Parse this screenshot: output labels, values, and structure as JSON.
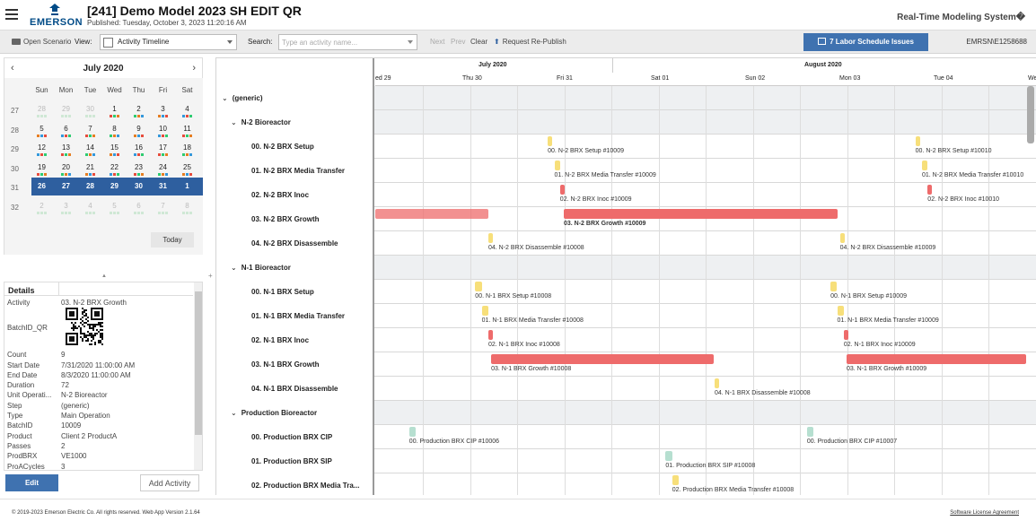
{
  "header": {
    "logo_text": "EMERSON",
    "title": "[241] Demo Model 2023 SH EDIT QR",
    "published": "Published: Tuesday, October 3, 2023 11:20:16 AM",
    "system_name": "Real-Time Modeling System�"
  },
  "toolbar": {
    "open_scenario": "Open Scenario",
    "view_label": "View:",
    "view_value": "Activity Timeline",
    "search_label": "Search:",
    "search_placeholder": "Type an activity name...",
    "next": "Next",
    "prev": "Prev",
    "clear": "Clear",
    "republish": "Request Re-Publish",
    "labor_issues": "7 Labor Schedule Issues",
    "user": "EMRSN\\E1258688"
  },
  "calendar": {
    "month_title": "July 2020",
    "prev_icon": "‹",
    "next_icon": "›",
    "day_names": [
      "Sun",
      "Mon",
      "Tue",
      "Wed",
      "Thu",
      "Fri",
      "Sat"
    ],
    "weeks": [
      {
        "num": "27",
        "days": [
          {
            "d": "28",
            "o": true
          },
          {
            "d": "29",
            "o": true
          },
          {
            "d": "30",
            "o": true
          },
          {
            "d": "1"
          },
          {
            "d": "2"
          },
          {
            "d": "3"
          },
          {
            "d": "4"
          }
        ]
      },
      {
        "num": "28",
        "days": [
          {
            "d": "5"
          },
          {
            "d": "6"
          },
          {
            "d": "7"
          },
          {
            "d": "8"
          },
          {
            "d": "9"
          },
          {
            "d": "10"
          },
          {
            "d": "11"
          }
        ]
      },
      {
        "num": "29",
        "days": [
          {
            "d": "12"
          },
          {
            "d": "13"
          },
          {
            "d": "14"
          },
          {
            "d": "15"
          },
          {
            "d": "16"
          },
          {
            "d": "17"
          },
          {
            "d": "18"
          }
        ]
      },
      {
        "num": "30",
        "days": [
          {
            "d": "19"
          },
          {
            "d": "20"
          },
          {
            "d": "21"
          },
          {
            "d": "22"
          },
          {
            "d": "23"
          },
          {
            "d": "24"
          },
          {
            "d": "25"
          }
        ]
      },
      {
        "num": "31",
        "selected": true,
        "days": [
          {
            "d": "26"
          },
          {
            "d": "27"
          },
          {
            "d": "28"
          },
          {
            "d": "29"
          },
          {
            "d": "30"
          },
          {
            "d": "31"
          },
          {
            "d": "1"
          }
        ]
      },
      {
        "num": "32",
        "days": [
          {
            "d": "2",
            "o": true
          },
          {
            "d": "3",
            "o": true
          },
          {
            "d": "4",
            "o": true
          },
          {
            "d": "5",
            "o": true
          },
          {
            "d": "6",
            "o": true
          },
          {
            "d": "7",
            "o": true
          },
          {
            "d": "8",
            "o": true
          }
        ]
      }
    ],
    "today_label": "Today"
  },
  "details": {
    "title": "Details",
    "rows": [
      {
        "k": "Activity",
        "v": "03. N-2 BRX Growth"
      },
      {
        "k": "BatchID_QR",
        "v": ""
      },
      {
        "k": "Count",
        "v": "9"
      },
      {
        "k": "Start Date",
        "v": "7/31/2020 11:00:00 AM"
      },
      {
        "k": "End Date",
        "v": "8/3/2020 11:00:00 AM"
      },
      {
        "k": "Duration",
        "v": "72"
      },
      {
        "k": "Unit Operati...",
        "v": "N-2 Bioreactor"
      },
      {
        "k": "Step",
        "v": "(generic)"
      },
      {
        "k": "Type",
        "v": "Main Operation"
      },
      {
        "k": "BatchID",
        "v": "10009"
      },
      {
        "k": "Product",
        "v": "Client 2 ProductA"
      },
      {
        "k": "Passes",
        "v": "2"
      },
      {
        "k": "ProdBRX",
        "v": "VE1000"
      },
      {
        "k": "ProACycles",
        "v": "3"
      }
    ],
    "edit_label": "Edit",
    "add_label": "Add Activity"
  },
  "gantt": {
    "months": [
      {
        "label": "July 2020",
        "day": 0
      },
      {
        "label": "August 2020",
        "day": 2
      }
    ],
    "days": [
      {
        "label": "ed 29",
        "day": -2
      },
      {
        "label": "Thu 30",
        "day": -1
      },
      {
        "label": "Fri 31",
        "day": 0
      },
      {
        "label": "Sat 01",
        "day": 1
      },
      {
        "label": "Sun 02",
        "day": 2
      },
      {
        "label": "Mon 03",
        "day": 3
      },
      {
        "label": "Tue 04",
        "day": 4
      },
      {
        "label": "We",
        "day": 5
      }
    ],
    "rows": [
      {
        "label": "(generic)",
        "level": 0,
        "group": true,
        "bars": []
      },
      {
        "label": "N-2 Bioreactor",
        "level": 1,
        "group": true,
        "bars": []
      },
      {
        "label": "00. N-2 BRX Setup",
        "level": 2,
        "bars": [
          {
            "start": -0.17,
            "dur": 0.04,
            "color": "yellow",
            "label": "00. N-2 BRX Setup #10009"
          },
          {
            "start": 3.73,
            "dur": 0.04,
            "color": "yellow",
            "label": "00. N-2 BRX Setup #10010"
          }
        ]
      },
      {
        "label": "01. N-2 BRX Media Transfer",
        "level": 2,
        "bars": [
          {
            "start": -0.1,
            "dur": 0.06,
            "color": "yellow",
            "label": "01. N-2 BRX Media Transfer #10009"
          },
          {
            "start": 3.8,
            "dur": 0.06,
            "color": "yellow",
            "label": "01. N-2 BRX Media Transfer #10010"
          }
        ]
      },
      {
        "label": "02. N-2 BRX Inoc",
        "level": 2,
        "bars": [
          {
            "start": -0.04,
            "dur": 0.04,
            "color": "red",
            "label": "02. N-2 BRX Inoc #10009"
          },
          {
            "start": 3.86,
            "dur": 0.04,
            "color": "red",
            "label": "02. N-2 BRX Inoc #10010"
          }
        ]
      },
      {
        "label": "03. N-2 BRX Growth",
        "level": 2,
        "bars": [
          {
            "start": -2.3,
            "dur": 1.5,
            "color": "red",
            "label": "",
            "faded": true
          },
          {
            "start": 0,
            "dur": 2.9,
            "color": "red",
            "label": "03. N-2 BRX Growth #10009",
            "bold": true
          }
        ]
      },
      {
        "label": "04. N-2 BRX Disassemble",
        "level": 2,
        "bars": [
          {
            "start": -0.8,
            "dur": 0.04,
            "color": "yellow",
            "label": "04. N-2 BRX Disassemble #10008"
          },
          {
            "start": 2.93,
            "dur": 0.04,
            "color": "yellow",
            "label": "04. N-2 BRX Disassemble #10009"
          }
        ]
      },
      {
        "label": "N-1 Bioreactor",
        "level": 1,
        "group": true,
        "bars": []
      },
      {
        "label": "00. N-1 BRX Setup",
        "level": 2,
        "bars": [
          {
            "start": -0.94,
            "dur": 0.07,
            "color": "yellow",
            "label": "00. N-1 BRX Setup #10008"
          },
          {
            "start": 2.83,
            "dur": 0.07,
            "color": "yellow",
            "label": "00. N-1 BRX Setup #10009"
          }
        ]
      },
      {
        "label": "01. N-1 BRX Media Transfer",
        "level": 2,
        "bars": [
          {
            "start": -0.87,
            "dur": 0.07,
            "color": "yellow",
            "label": "01. N-1 BRX Media Transfer #10008"
          },
          {
            "start": 2.9,
            "dur": 0.07,
            "color": "yellow",
            "label": "01. N-1 BRX Media Transfer #10009"
          }
        ]
      },
      {
        "label": "02. N-1 BRX Inoc",
        "level": 2,
        "bars": [
          {
            "start": -0.8,
            "dur": 0.04,
            "color": "red",
            "label": "02. N-1 BRX Inoc #10008"
          },
          {
            "start": 2.97,
            "dur": 0.04,
            "color": "red",
            "label": "02. N-1 BRX Inoc #10009"
          }
        ]
      },
      {
        "label": "03. N-1 BRX Growth",
        "level": 2,
        "bars": [
          {
            "start": -0.77,
            "dur": 2.36,
            "color": "red",
            "label": "03. N-1 BRX Growth #10008"
          },
          {
            "start": 3.0,
            "dur": 1.9,
            "color": "red",
            "label": "03. N-1 BRX Growth #10009"
          }
        ]
      },
      {
        "label": "04. N-1 BRX Disassemble",
        "level": 2,
        "bars": [
          {
            "start": 1.6,
            "dur": 0.04,
            "color": "yellow",
            "label": "04. N-1 BRX Disassemble #10008"
          }
        ]
      },
      {
        "label": "Production Bioreactor",
        "level": 1,
        "group": true,
        "bars": []
      },
      {
        "label": "00. Production BRX CIP",
        "level": 2,
        "bars": [
          {
            "start": -1.64,
            "dur": 0.07,
            "color": "teal",
            "label": "00. Production BRX CIP #10006"
          },
          {
            "start": 2.58,
            "dur": 0.07,
            "color": "teal",
            "label": "00. Production BRX CIP #10007"
          }
        ]
      },
      {
        "label": "01. Production BRX SIP",
        "level": 2,
        "bars": [
          {
            "start": 1.08,
            "dur": 0.07,
            "color": "teal",
            "label": "01. Production BRX SIP #10008"
          }
        ]
      },
      {
        "label": "02. Production BRX Media Tra...",
        "level": 2,
        "bars": [
          {
            "start": 1.15,
            "dur": 0.07,
            "color": "yellow",
            "label": "02. Production BRX Media Transfer #10008"
          }
        ]
      }
    ]
  },
  "colors": {
    "accent": "#3f72b0",
    "select_band": "#2e5f9f",
    "bar_red": "#ee6b6b",
    "bar_yellow": "#f7df7a",
    "bar_teal": "#b6dfd0"
  },
  "footer": {
    "copyright": "© 2019-2023 Emerson Electric Co. All rights reserved.    Web App Version 2.1.64",
    "license": "Software License Agreement"
  }
}
